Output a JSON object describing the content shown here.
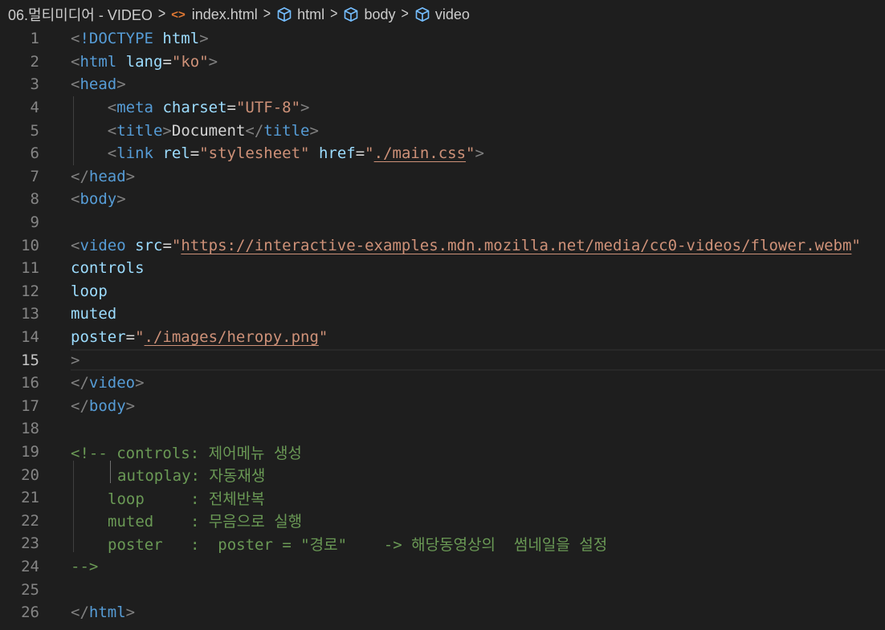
{
  "breadcrumb": {
    "folder": "06.멀티미디어 - VIDEO",
    "file": "index.html",
    "path": [
      "html",
      "body",
      "video"
    ]
  },
  "editor": {
    "current_line": 15,
    "lines": [
      {
        "n": "1"
      },
      {
        "n": "2"
      },
      {
        "n": "3"
      },
      {
        "n": "4"
      },
      {
        "n": "5"
      },
      {
        "n": "6"
      },
      {
        "n": "7"
      },
      {
        "n": "8"
      },
      {
        "n": "9"
      },
      {
        "n": "10"
      },
      {
        "n": "11"
      },
      {
        "n": "12"
      },
      {
        "n": "13"
      },
      {
        "n": "14"
      },
      {
        "n": "15"
      },
      {
        "n": "16"
      },
      {
        "n": "17"
      },
      {
        "n": "18"
      },
      {
        "n": "19"
      },
      {
        "n": "20"
      },
      {
        "n": "21"
      },
      {
        "n": "22"
      },
      {
        "n": "23"
      },
      {
        "n": "24"
      },
      {
        "n": "25"
      },
      {
        "n": "26"
      }
    ],
    "tokens": {
      "doctype": "!DOCTYPE",
      "html": "html",
      "lang": "lang",
      "ko": "\"ko\"",
      "head": "head",
      "meta": "meta",
      "charset": "charset",
      "utf8": "\"UTF-8\"",
      "title": "title",
      "document": "Document",
      "link": "link",
      "rel": "rel",
      "stylesheet": "\"stylesheet\"",
      "href": "href",
      "quote": "\"",
      "main_css": "./main.css",
      "body": "body",
      "video": "video",
      "src": "src",
      "video_url": "https://interactive-examples.mdn.mozilla.net/media/cc0-videos/flower.webm",
      "controls": "controls",
      "loop": "loop",
      "muted": "muted",
      "poster": "poster",
      "poster_path": "./images/heropy.png",
      "comment_19": "<!-- controls: 제어메뉴 생성",
      "comment_20": "autoplay: 자동재생",
      "comment_21": "loop     : 전체반복",
      "comment_22": "muted    : 무음으로 실행",
      "comment_23": "poster   :  poster = \"경로\"    -> 해당동영상의  썸네일을 설정",
      "comment_24": "-->"
    }
  },
  "colors": {
    "background": "#1e1e1e",
    "tag": "#569cd6",
    "attribute": "#9cdcfe",
    "string": "#ce9178",
    "comment": "#6a9955",
    "line_number": "#858585"
  }
}
